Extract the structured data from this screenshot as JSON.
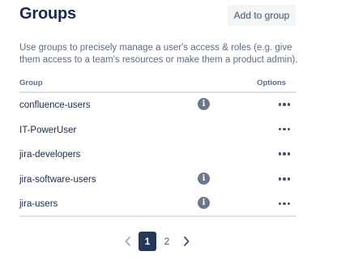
{
  "header": {
    "title": "Groups",
    "add_button_label": "Add to group"
  },
  "description": "Use groups to precisely manage a user's access & roles (e.g. give them access to a team's resources or make them a product admin).",
  "table": {
    "columns": [
      "Group",
      "Options"
    ],
    "rows": [
      {
        "name": "confluence-users",
        "info": true,
        "info_icon": "i"
      },
      {
        "name": "IT-PowerUser",
        "info": false
      },
      {
        "name": "jira-developers",
        "info": false
      },
      {
        "name": "jira-software-users",
        "info": true,
        "info_icon": "i"
      },
      {
        "name": "jira-users",
        "info": true,
        "info_icon": "i"
      }
    ]
  },
  "pagination": {
    "pages": [
      "1",
      "2"
    ],
    "current": "1"
  },
  "colors": {
    "text_primary": "#172b4d",
    "text_secondary": "#5e6c84",
    "button_bg": "#f4f5f7",
    "current_page_bg": "#253858",
    "info_icon_bg": "#6b778c",
    "divider": "#dfe1e6"
  }
}
